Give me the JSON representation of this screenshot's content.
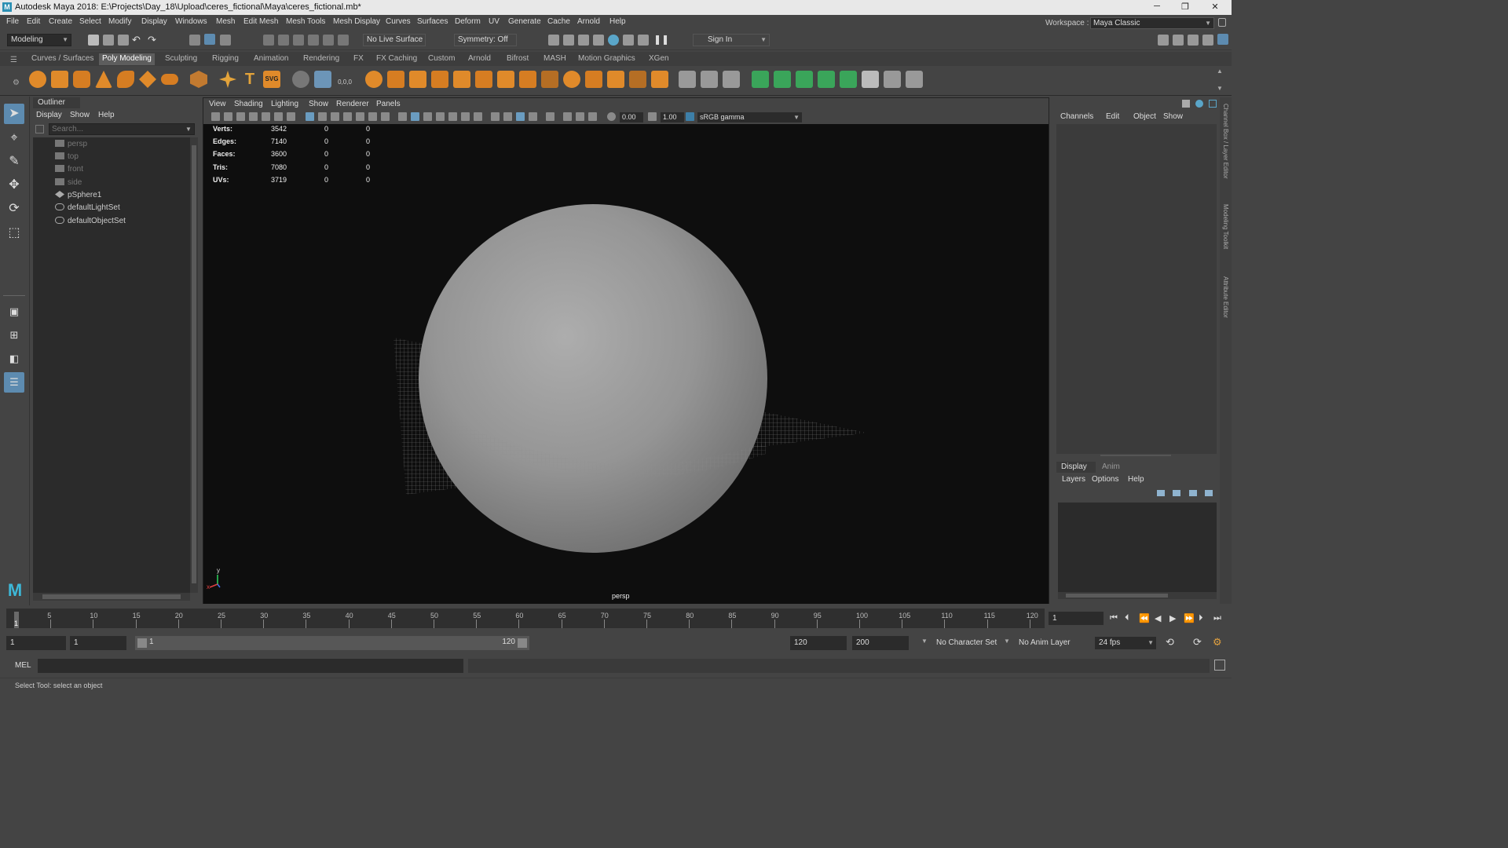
{
  "window": {
    "title": "Autodesk Maya 2018: E:\\Projects\\Day_18\\Upload\\ceres_fictional\\Maya\\ceres_fictional.mb*",
    "logo_letter": "M",
    "minimize": "─",
    "restore": "❐",
    "close": "✕"
  },
  "menubar": {
    "items": [
      "File",
      "Edit",
      "Create",
      "Select",
      "Modify",
      "Display",
      "Windows",
      "Mesh",
      "Edit Mesh",
      "Mesh Tools",
      "Mesh Display",
      "Curves",
      "Surfaces",
      "Deform",
      "UV",
      "Generate",
      "Cache",
      "Arnold",
      "Help"
    ],
    "workspace_label": "Workspace :",
    "workspace_value": "Maya Classic"
  },
  "statusline": {
    "mode": "Modeling",
    "live_surface": "No Live Surface",
    "symmetry": "Symmetry: Off",
    "sign_in": "Sign In"
  },
  "shelf": {
    "tabs": [
      "Curves / Surfaces",
      "Poly Modeling",
      "Sculpting",
      "Rigging",
      "Animation",
      "Rendering",
      "FX",
      "FX Caching",
      "Custom",
      "Arnold",
      "Bifrost",
      "MASH",
      "Motion Graphics",
      "XGen"
    ],
    "active_tab": "Poly Modeling",
    "text_icon": "T",
    "svg_icon": "SVG",
    "coords_icon": "0,0,0"
  },
  "outliner": {
    "title": "Outliner",
    "menu": [
      "Display",
      "Show",
      "Help"
    ],
    "search_placeholder": "Search...",
    "items": [
      {
        "label": "persp",
        "icon": "camera-icon",
        "dim": true
      },
      {
        "label": "top",
        "icon": "camera-icon",
        "dim": true
      },
      {
        "label": "front",
        "icon": "camera-icon",
        "dim": true
      },
      {
        "label": "side",
        "icon": "camera-icon",
        "dim": true
      },
      {
        "label": "pSphere1",
        "icon": "transform-icon",
        "dim": false
      },
      {
        "label": "defaultLightSet",
        "icon": "set-icon",
        "dim": false
      },
      {
        "label": "defaultObjectSet",
        "icon": "set-icon",
        "dim": false
      }
    ]
  },
  "viewport": {
    "menu": [
      "View",
      "Shading",
      "Lighting",
      "Show",
      "Renderer",
      "Panels"
    ],
    "exposure": "0.00",
    "gamma": "1.00",
    "color_space": "sRGB gamma",
    "camera": "persp",
    "axis_y": "y",
    "axis_x": "x",
    "hud": [
      {
        "label": "Verts:",
        "a": "3542",
        "b": "0",
        "c": "0"
      },
      {
        "label": "Edges:",
        "a": "7140",
        "b": "0",
        "c": "0"
      },
      {
        "label": "Faces:",
        "a": "3600",
        "b": "0",
        "c": "0"
      },
      {
        "label": "Tris:",
        "a": "7080",
        "b": "0",
        "c": "0"
      },
      {
        "label": "UVs:",
        "a": "3719",
        "b": "0",
        "c": "0"
      }
    ]
  },
  "channelbox": {
    "menu": [
      "Channels",
      "Edit",
      "Object",
      "Show"
    ],
    "layer_tabs": [
      "Display",
      "Anim"
    ],
    "layer_menu": [
      "Layers",
      "Options",
      "Help"
    ],
    "side_labels": [
      "Channel Box / Layer Editor",
      "Modeling Toolkit",
      "Attribute Editor"
    ]
  },
  "timeline": {
    "ticks": [
      "5",
      "10",
      "15",
      "20",
      "25",
      "30",
      "35",
      "40",
      "45",
      "50",
      "55",
      "60",
      "65",
      "70",
      "75",
      "80",
      "85",
      "90",
      "95",
      "100",
      "105",
      "110",
      "115",
      "120"
    ],
    "current_marker": "1",
    "current_frame": "1"
  },
  "range": {
    "start_time": "1",
    "playback_start": "1",
    "range_start": "1",
    "range_end": "120",
    "playback_end": "120",
    "end_time": "200",
    "character_set": "No Character Set",
    "anim_layer": "No Anim Layer",
    "fps": "24 fps"
  },
  "command": {
    "label": "MEL",
    "help": "Select Tool: select an object"
  },
  "colors": {
    "accent": "#5d8bb0",
    "viewport_bg": "#0e0e0e"
  }
}
